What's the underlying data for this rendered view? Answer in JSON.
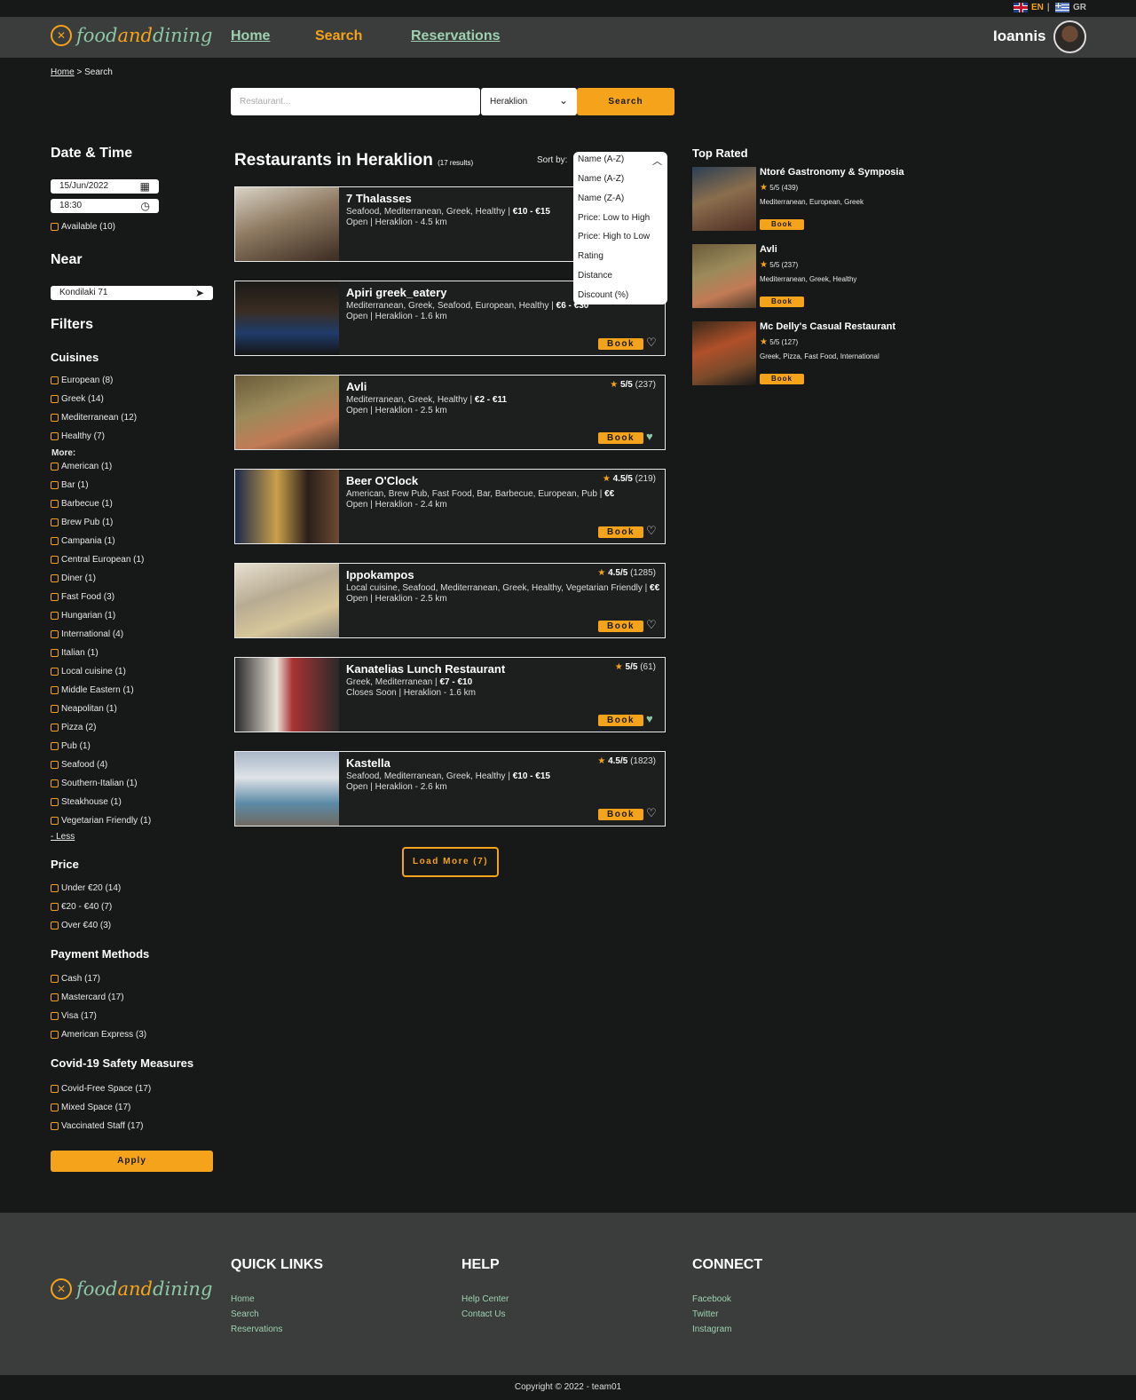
{
  "lang": {
    "en": "EN",
    "gr": "GR",
    "separator": "|"
  },
  "brand": {
    "name_food": "food",
    "name_and": "and",
    "name_dining": "dining"
  },
  "nav": {
    "home": "Home",
    "search": "Search",
    "reservations": "Reservations"
  },
  "user": {
    "name": "Ioannis"
  },
  "breadcrumb": {
    "home": "Home",
    "sep": ">",
    "current": "Search"
  },
  "search": {
    "placeholder": "Restaurant...",
    "city": "Heraklion",
    "button": "Search"
  },
  "sidebar": {
    "date_time_title": "Date & Time",
    "date": "15/Jun/2022",
    "time": "18:30",
    "available": "Available (10)",
    "near_title": "Near",
    "near_value": "Kondilaki 71",
    "filters_title": "Filters",
    "cuisines_title": "Cuisines",
    "cuisines_top": [
      "European (8)",
      "Greek (14)",
      "Mediterranean (12)",
      "Healthy (7)"
    ],
    "more_label": "More:",
    "cuisines_more": [
      "American (1)",
      "Bar (1)",
      "Barbecue (1)",
      "Brew Pub (1)",
      "Campania (1)",
      "Central European (1)",
      "Diner (1)",
      "Fast Food (3)",
      "Hungarian (1)",
      "International (4)",
      "Italian (1)",
      "Local cuisine (1)",
      "Middle Eastern (1)",
      "Neapolitan (1)",
      "Pizza  (2)",
      "Pub (1)",
      "Seafood (4)",
      "Southern-Italian (1)",
      "Steakhouse (1)",
      "Vegetarian Friendly (1)"
    ],
    "less_link": "- Less",
    "price_title": "Price",
    "price": [
      "Under €20 (14)",
      "€20 - €40 (7)",
      "Over €40 (3)"
    ],
    "payment_title": "Payment Methods",
    "payment": [
      "Cash (17)",
      "Mastercard (17)",
      "Visa (17)",
      "American Express (3)"
    ],
    "covid_title": "Covid-19 Safety Measures",
    "covid": [
      "Covid-Free Space (17)",
      "Mixed Space (17)",
      "Vaccinated Staff (17)"
    ],
    "apply": "Apply"
  },
  "results": {
    "title": "Restaurants in Heraklion",
    "count": "(17 results)",
    "sort_label": "Sort by:",
    "sort_selected": "Name (A-Z)",
    "sort_options": [
      "Name (A-Z)",
      "Name (Z-A)",
      "Price: Low to High",
      "Price: High to Low",
      "Rating",
      "Distance",
      "Discount (%)"
    ],
    "book_label": "Book",
    "items": [
      {
        "name": "7 Thalasses",
        "tags": "Seafood, Mediterranean, Greek, Healthy | ",
        "price": "€10 - €15",
        "status": "Open | Heraklion - 4.5 km",
        "rating": "",
        "reviews": "",
        "favorite": false
      },
      {
        "name": "Apiri greek_eatery",
        "tags": "Mediterranean, Greek, Seafood, European, Healthy | ",
        "price": "€6 - €30",
        "status": "Open | Heraklion - 1.6 km",
        "rating": "",
        "reviews": "",
        "favorite": false
      },
      {
        "name": "Avli",
        "tags": "Mediterranean, Greek, Healthy | ",
        "price": "€2 - €11",
        "status": "Open | Heraklion - 2.5 km",
        "rating": "5/5",
        "reviews": "(237)",
        "favorite": true
      },
      {
        "name": "Beer O'Clock",
        "tags": "American, Brew Pub, Fast Food, Bar, Barbecue, European, Pub | ",
        "price": "€€",
        "status": "Open | Heraklion - 2.4 km",
        "rating": "4.5/5",
        "reviews": "(219)",
        "favorite": false
      },
      {
        "name": "Ippokampos",
        "tags": "Local cuisine, Seafood, Mediterranean, Greek, Healthy, Vegetarian Friendly | ",
        "price": "€€",
        "status": "Open | Heraklion - 2.5 km",
        "rating": "4.5/5",
        "reviews": "(1285)",
        "favorite": false
      },
      {
        "name": "Kanatelias Lunch Restaurant",
        "tags": "Greek, Mediterranean | ",
        "price": "€7 - €10",
        "status": "Closes Soon | Heraklion - 1.6 km",
        "rating": "5/5",
        "reviews": "(61)",
        "favorite": true
      },
      {
        "name": "Kastella",
        "tags": "Seafood, Mediterranean, Greek, Healthy | ",
        "price": "€10 - €15",
        "status": "Open | Heraklion - 2.6 km",
        "rating": "4.5/5",
        "reviews": "(1823)",
        "favorite": false
      }
    ],
    "load_more": "Load More (7)"
  },
  "top_rated": {
    "title": "Top Rated",
    "book_label": "Book",
    "items": [
      {
        "name": "Ntoré Gastronomy & Symposia",
        "rating": "5/5 (439)",
        "tags": "Mediterranean, European, Greek"
      },
      {
        "name": "Avli",
        "rating": "5/5 (237)",
        "tags": "Mediterranean, Greek, Healthy"
      },
      {
        "name": "Mc Delly's Casual Restaurant",
        "rating": "5/5 (127)",
        "tags": "Greek, Pizza, Fast Food, International"
      }
    ]
  },
  "footer": {
    "quick_links_title": "QUICK LINKS",
    "quick_links": [
      "Home",
      "Search",
      "Reservations"
    ],
    "help_title": "HELP",
    "help_links": [
      "Help Center",
      "Contact Us"
    ],
    "connect_title": "CONNECT",
    "connect_links": [
      "Facebook",
      "Twitter",
      "Instagram"
    ],
    "copyright": "Copyright © 2022 - team01"
  },
  "colors": {
    "accent": "#f5a31a",
    "link_green": "#9fd0b0",
    "header_bg": "#3a3d3b",
    "page_bg": "#161917"
  }
}
